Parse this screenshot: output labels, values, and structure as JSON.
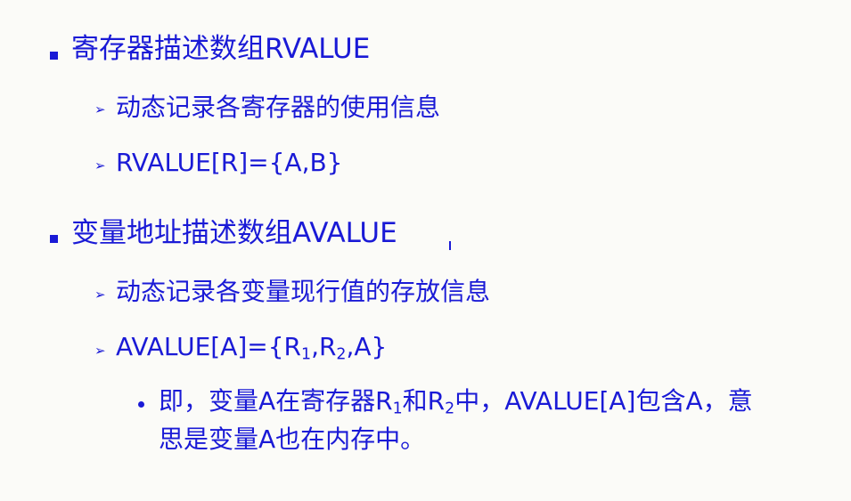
{
  "slide": {
    "section1": {
      "heading": "寄存器描述数组RVALUE",
      "items": [
        "动态记录各寄存器的使用信息",
        "RVALUE[R]={A,B}"
      ]
    },
    "section2": {
      "heading": "变量地址描述数组AVALUE",
      "items": [
        "动态记录各变量现行值的存放信息"
      ],
      "formula": {
        "prefix": "AVALUE[A]={R",
        "sub1": "1",
        "mid": ",R",
        "sub2": "2",
        "suffix": ",A}"
      },
      "note": {
        "part1": "即，变量A在寄存器R",
        "sub1": "1",
        "part2": "和R",
        "sub2": "2",
        "part3": "中，AVALUE[A]包含A，意",
        "line2": "思是变量A也在内存中。"
      }
    }
  }
}
